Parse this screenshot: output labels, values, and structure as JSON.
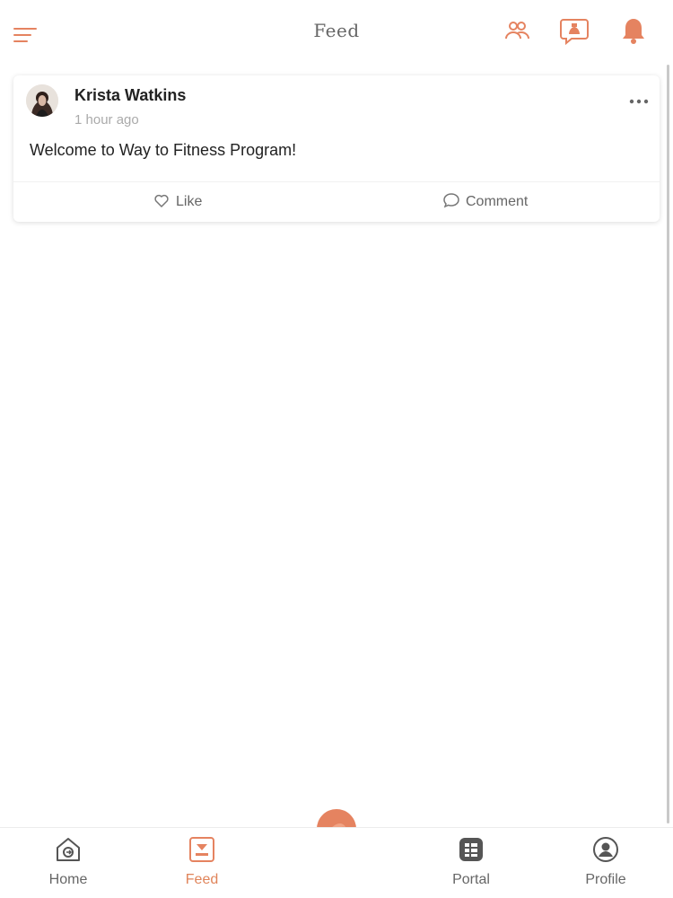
{
  "colors": {
    "accent": "#e58360",
    "text": "#222222",
    "muted": "#666666",
    "timestamp": "#aaaaaa"
  },
  "header": {
    "title": "Feed",
    "menu_icon": "hamburger-menu-icon",
    "icons": [
      "groups-icon",
      "chat-bubble-icon",
      "bell-icon"
    ]
  },
  "post": {
    "author": "Krista Watkins",
    "time": "1 hour ago",
    "text": "Welcome to Way to Fitness Program!",
    "like_label": "Like",
    "comment_label": "Comment",
    "more_icon": "more-horizontal-icon"
  },
  "bottom_nav": {
    "items": [
      {
        "label": "Home",
        "icon": "home-icon",
        "active": false
      },
      {
        "label": "Feed",
        "icon": "feed-icon",
        "active": true
      },
      {
        "label": "Portal",
        "icon": "portal-grid-icon",
        "active": false
      },
      {
        "label": "Profile",
        "icon": "profile-icon",
        "active": false
      }
    ],
    "center_button_icon": "center-action-icon"
  }
}
